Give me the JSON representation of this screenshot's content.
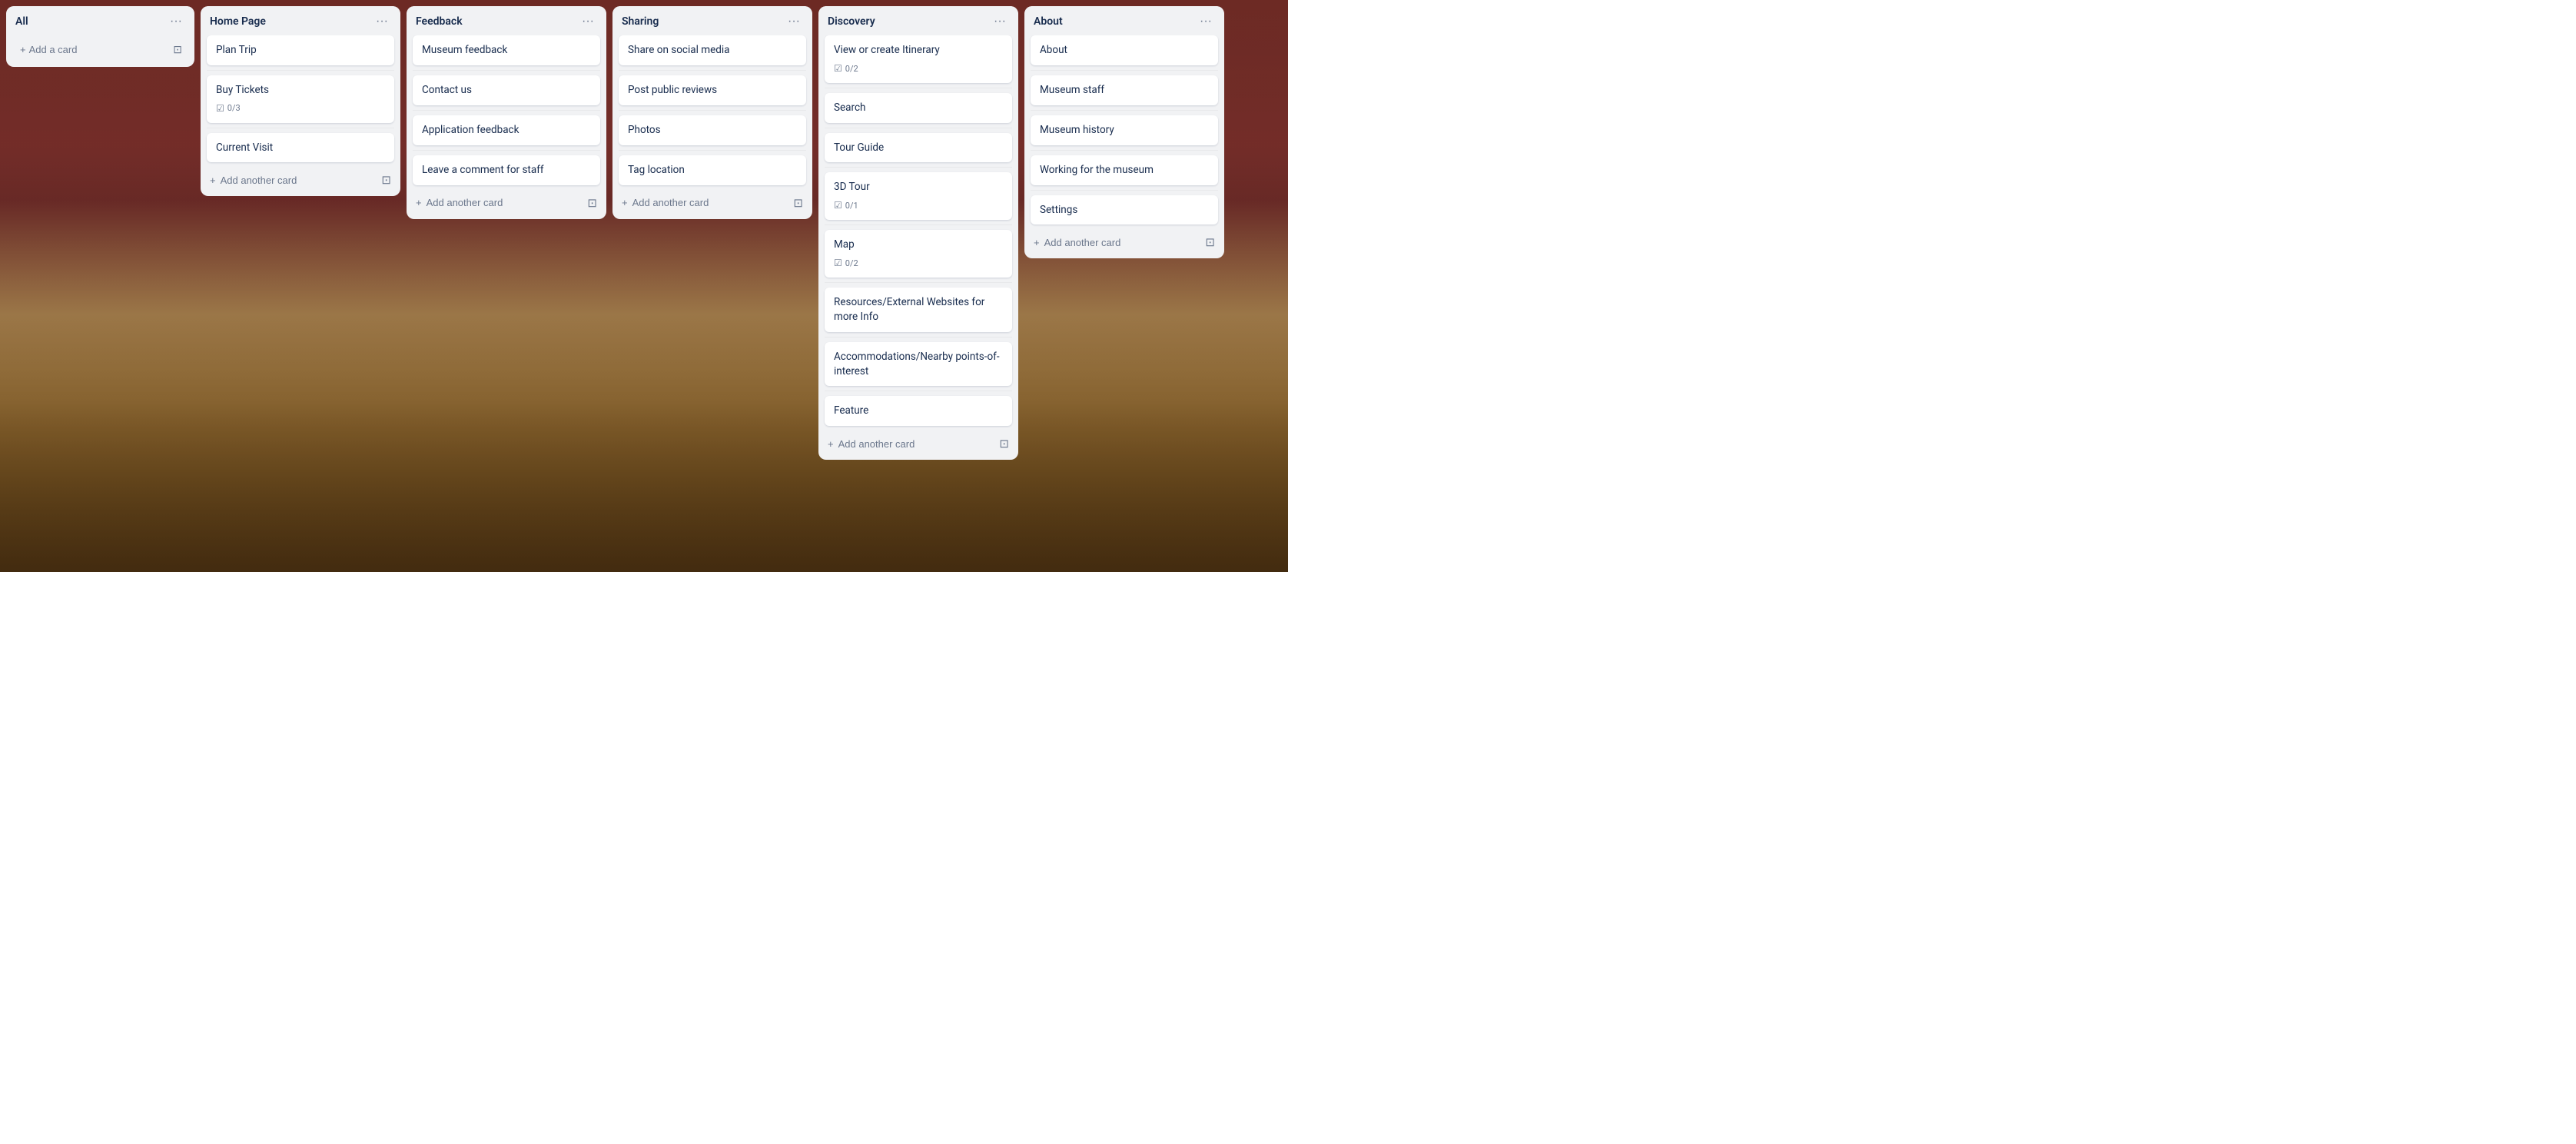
{
  "board": {
    "background": "museum",
    "columns": [
      {
        "id": "all",
        "title": "All",
        "cards": [],
        "add_card_label": "Add a card",
        "show_add_card": true
      },
      {
        "id": "home-page",
        "title": "Home Page",
        "cards": [
          {
            "id": "c1",
            "text": "Plan Trip",
            "meta": null
          },
          {
            "id": "c2",
            "text": "Buy Tickets",
            "meta": "0/3"
          },
          {
            "id": "c3",
            "text": "Current Visit",
            "meta": null
          }
        ],
        "add_card_label": "Add another card"
      },
      {
        "id": "feedback",
        "title": "Feedback",
        "cards": [
          {
            "id": "c4",
            "text": "Museum feedback",
            "meta": null
          },
          {
            "id": "c5",
            "text": "Contact us",
            "meta": null
          },
          {
            "id": "c6",
            "text": "Application feedback",
            "meta": null
          },
          {
            "id": "c7",
            "text": "Leave a comment for staff",
            "meta": null
          }
        ],
        "add_card_label": "Add another card"
      },
      {
        "id": "sharing",
        "title": "Sharing",
        "cards": [
          {
            "id": "c8",
            "text": "Share on social media",
            "meta": null
          },
          {
            "id": "c9",
            "text": "Post public reviews",
            "meta": null
          },
          {
            "id": "c10",
            "text": "Photos",
            "meta": null
          },
          {
            "id": "c11",
            "text": "Tag location",
            "meta": null
          }
        ],
        "add_card_label": "Add another card"
      },
      {
        "id": "discovery",
        "title": "Discovery",
        "cards": [
          {
            "id": "c12",
            "text": "View or create Itinerary",
            "meta": "0/2"
          },
          {
            "id": "c13",
            "text": "Search",
            "meta": null
          },
          {
            "id": "c14",
            "text": "Tour Guide",
            "meta": null
          },
          {
            "id": "c15",
            "text": "3D Tour",
            "meta": "0/1"
          },
          {
            "id": "c16",
            "text": "Map",
            "meta": "0/2"
          },
          {
            "id": "c17",
            "text": "Resources/External Websites for more Info",
            "meta": null
          },
          {
            "id": "c18",
            "text": "Accommodations/Nearby points-of-interest",
            "meta": null
          },
          {
            "id": "c19",
            "text": "Feature",
            "meta": null
          }
        ],
        "add_card_label": "Add another card"
      },
      {
        "id": "about",
        "title": "About",
        "cards": [
          {
            "id": "c20",
            "text": "About",
            "meta": null
          },
          {
            "id": "c21",
            "text": "Museum staff",
            "meta": null
          },
          {
            "id": "c22",
            "text": "Museum history",
            "meta": null
          },
          {
            "id": "c23",
            "text": "Working for the museum",
            "meta": null
          },
          {
            "id": "c24",
            "text": "Settings",
            "meta": null
          }
        ],
        "add_card_label": "Add another card"
      }
    ],
    "menu_icon": "···",
    "add_icon": "+",
    "archive_icon": "⊡",
    "checklist_icon": "☑"
  }
}
